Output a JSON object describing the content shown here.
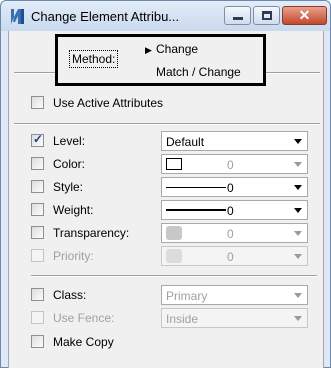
{
  "window": {
    "title": "Change Element Attribu...",
    "icon": "microstation-logo-icon",
    "controls": {
      "minimize": "minimize-icon",
      "maximize": "maximize-icon",
      "close": "close-icon"
    }
  },
  "method": {
    "label": "Method:",
    "items": [
      "Change",
      "Match / Change"
    ],
    "selected": "Change"
  },
  "use_active_attributes": {
    "label": "Use Active Attributes",
    "checked": false
  },
  "attributes": [
    {
      "label": "Level:",
      "checked": true,
      "value": "Default"
    },
    {
      "label": "Color:",
      "checked": false,
      "value": "0"
    },
    {
      "label": "Style:",
      "checked": false,
      "value": "0"
    },
    {
      "label": "Weight:",
      "checked": false,
      "value": "0"
    },
    {
      "label": "Transparency:",
      "checked": false,
      "value": "0"
    },
    {
      "label": "Priority:",
      "checked": false,
      "value": "0"
    }
  ],
  "class": {
    "label": "Class:",
    "checked": false,
    "value": "Primary"
  },
  "use_fence": {
    "label": "Use Fence:",
    "checked": false,
    "value": "Inside"
  },
  "make_copy": {
    "label": "Make Copy",
    "checked": false
  }
}
